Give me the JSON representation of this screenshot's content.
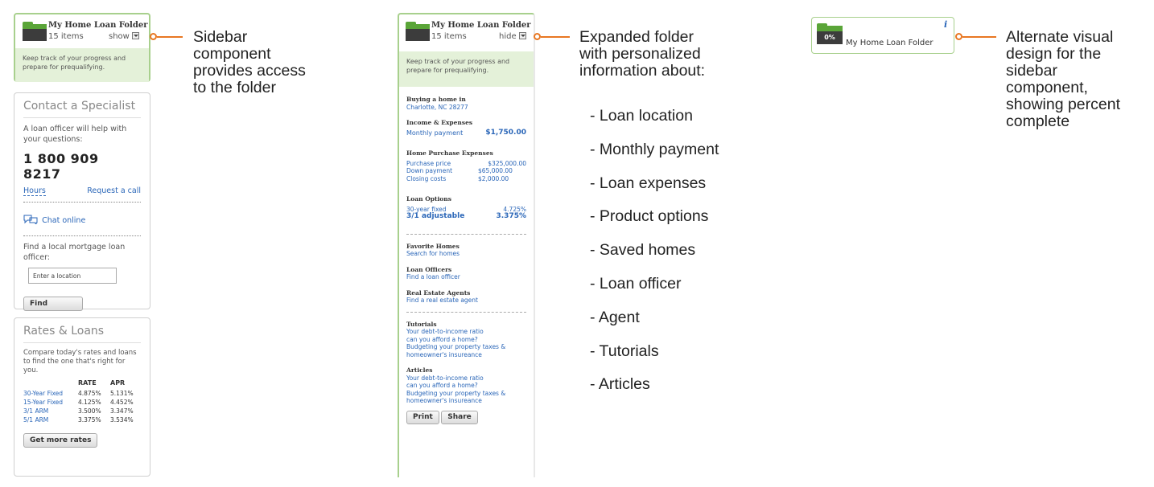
{
  "folder": {
    "title": "My Home Loan Folder",
    "count": "15 items",
    "show_label": "show",
    "hide_label": "hide",
    "note": "Keep track of your progress and prepare for prequalifying."
  },
  "contact": {
    "title": "Contact a Specialist",
    "intro": "A loan officer will help with your questions:",
    "phone": "1 800 909 8217",
    "hours": "Hours",
    "request_call": "Request a call",
    "chat": "Chat online",
    "find_text": "Find a local mortgage loan officer:",
    "location_placeholder": "Enter a location",
    "find_button": "Find"
  },
  "rates": {
    "title": "Rates & Loans",
    "intro": "Compare today's rates and loans to find the one that's right for you.",
    "headers": [
      "RATE",
      "APR"
    ],
    "rows": [
      {
        "name": "30-Year Fixed",
        "rate": "4.875%",
        "apr": "5.131%"
      },
      {
        "name": "15-Year Fixed",
        "rate": "4.125%",
        "apr": "4.452%"
      },
      {
        "name": "3/1 ARM",
        "rate": "3.500%",
        "apr": "3.347%"
      },
      {
        "name": "5/1 ARM",
        "rate": "3.375%",
        "apr": "3.534%"
      }
    ],
    "more_button": "Get more rates"
  },
  "expanded": {
    "buying_h": "Buying a home in",
    "buying_loc": "Charlotte, NC 28277",
    "income_h": "Income & Expenses",
    "monthly_label": "Monthly payment",
    "monthly_value": "$1,750.00",
    "purchase_h": "Home Purchase Expenses",
    "purchase_label": "Purchase price",
    "purchase_value": "$325,000.00",
    "down_label": "Down payment",
    "down_value": "$65,000.00",
    "closing_label": "Closing costs",
    "closing_value": "$2,000.00",
    "loan_h": "Loan Options",
    "opt1_label": "30-year fixed",
    "opt1_value": "4.725%",
    "opt2_label": "3/1 adjustable",
    "opt2_value": "3.375%",
    "fav_h": "Favorite Homes",
    "fav_link": "Search for homes",
    "officers_h": "Loan Officers",
    "officers_link": "Find a loan officer",
    "agents_h": "Real Estate Agents",
    "agents_link": "Find a real estate agent",
    "tutorials_h": "Tutorials",
    "tut1": "Your debt-to-income ratio",
    "tut2": "can you afford a home?",
    "tut3": "Budgeting your property taxes &",
    "tut4": "homeowner's insureance",
    "articles_h": "Articles",
    "art1": "Your debt-to-income ratio",
    "art2": "can you afford a home?",
    "art3": "Budgeting your property taxes &",
    "art4": "homeowner's insureance",
    "print_button": "Print",
    "share_button": "Share"
  },
  "compact": {
    "percent": "0%",
    "title": "My Home Loan Folder",
    "info": "i"
  },
  "callouts": {
    "sidebar": [
      "Sidebar",
      "component",
      "provides access",
      "to the folder"
    ],
    "expanded": [
      "Expanded folder",
      "with personalized",
      "information about:"
    ],
    "bullets": [
      "- Loan location",
      "- Monthly payment",
      "- Loan expenses",
      "- Product options",
      "- Saved homes",
      "- Loan officer",
      "- Agent",
      "- Tutorials",
      "- Articles"
    ],
    "alternate": [
      "Alternate visual",
      "design for the",
      "sidebar",
      "component,",
      "showing percent",
      "complete"
    ]
  },
  "colors": {
    "accent": "#e87722",
    "folder_green": "#5aa538",
    "link_blue": "#2a66b8",
    "note_bg": "#e4f1d9"
  }
}
